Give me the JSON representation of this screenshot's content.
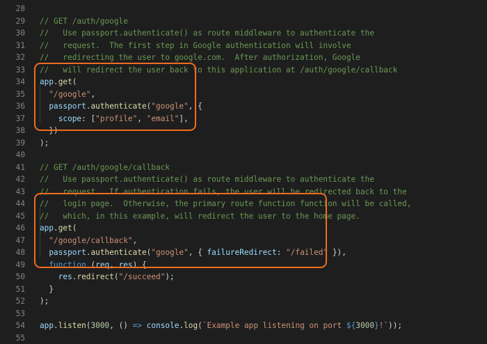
{
  "editor": {
    "lines": [
      {
        "num": "28",
        "tokens": []
      },
      {
        "num": "29",
        "tokens": [
          {
            "t": "c",
            "v": "// GET /auth/google"
          }
        ]
      },
      {
        "num": "30",
        "tokens": [
          {
            "t": "c",
            "v": "//   Use passport.authenticate() as route middleware to authenticate the"
          }
        ]
      },
      {
        "num": "31",
        "tokens": [
          {
            "t": "c",
            "v": "//   request.  The first step in Google authentication will involve"
          }
        ]
      },
      {
        "num": "32",
        "tokens": [
          {
            "t": "c",
            "v": "//   redirecting the user to google.com.  After authorization, Google"
          }
        ]
      },
      {
        "num": "33",
        "tokens": [
          {
            "t": "c",
            "v": "//   will redirect the user back to this application at /auth/google/callback"
          }
        ]
      },
      {
        "num": "34",
        "tokens": [
          {
            "t": "v",
            "v": "app"
          },
          {
            "t": "p",
            "v": "."
          },
          {
            "t": "f",
            "v": "get"
          },
          {
            "t": "p",
            "v": "("
          }
        ]
      },
      {
        "num": "35",
        "tokens": [
          {
            "t": "p",
            "v": "  "
          },
          {
            "t": "s",
            "v": "\"/google\""
          },
          {
            "t": "p",
            "v": ","
          }
        ]
      },
      {
        "num": "36",
        "tokens": [
          {
            "t": "p",
            "v": "  "
          },
          {
            "t": "v",
            "v": "passport"
          },
          {
            "t": "p",
            "v": "."
          },
          {
            "t": "f",
            "v": "authenticate"
          },
          {
            "t": "p",
            "v": "("
          },
          {
            "t": "s",
            "v": "\"google\""
          },
          {
            "t": "p",
            "v": ", {"
          }
        ]
      },
      {
        "num": "37",
        "tokens": [
          {
            "t": "p",
            "v": "    "
          },
          {
            "t": "v",
            "v": "scope"
          },
          {
            "t": "p",
            "v": ": ["
          },
          {
            "t": "s",
            "v": "\"profile\""
          },
          {
            "t": "p",
            "v": ", "
          },
          {
            "t": "s",
            "v": "\"email\""
          },
          {
            "t": "p",
            "v": "],"
          }
        ]
      },
      {
        "num": "38",
        "tokens": [
          {
            "t": "p",
            "v": "  })"
          }
        ]
      },
      {
        "num": "39",
        "tokens": [
          {
            "t": "p",
            "v": ");"
          }
        ]
      },
      {
        "num": "40",
        "tokens": []
      },
      {
        "num": "41",
        "tokens": [
          {
            "t": "c",
            "v": "// GET /auth/google/callback"
          }
        ]
      },
      {
        "num": "42",
        "tokens": [
          {
            "t": "c",
            "v": "//   Use passport.authenticate() as route middleware to authenticate the"
          }
        ]
      },
      {
        "num": "43",
        "tokens": [
          {
            "t": "c",
            "v": "//   request.  If authentication fails, the user will be redirected back to the"
          }
        ]
      },
      {
        "num": "44",
        "tokens": [
          {
            "t": "c",
            "v": "//   login page.  Otherwise, the primary route function function will be called,"
          }
        ]
      },
      {
        "num": "45",
        "tokens": [
          {
            "t": "c",
            "v": "//   which, in this example, will redirect the user to the home page."
          }
        ]
      },
      {
        "num": "46",
        "tokens": [
          {
            "t": "v",
            "v": "app"
          },
          {
            "t": "p",
            "v": "."
          },
          {
            "t": "f",
            "v": "get"
          },
          {
            "t": "p",
            "v": "("
          }
        ]
      },
      {
        "num": "47",
        "tokens": [
          {
            "t": "p",
            "v": "  "
          },
          {
            "t": "s",
            "v": "\"/google/callback\""
          },
          {
            "t": "p",
            "v": ","
          }
        ]
      },
      {
        "num": "48",
        "tokens": [
          {
            "t": "p",
            "v": "  "
          },
          {
            "t": "v",
            "v": "passport"
          },
          {
            "t": "p",
            "v": "."
          },
          {
            "t": "f",
            "v": "authenticate"
          },
          {
            "t": "p",
            "v": "("
          },
          {
            "t": "s",
            "v": "\"google\""
          },
          {
            "t": "p",
            "v": ", { "
          },
          {
            "t": "v",
            "v": "failureRedirect"
          },
          {
            "t": "p",
            "v": ": "
          },
          {
            "t": "s",
            "v": "\"/failed\""
          },
          {
            "t": "p",
            "v": " }),"
          }
        ]
      },
      {
        "num": "49",
        "tokens": [
          {
            "t": "p",
            "v": "  "
          },
          {
            "t": "k",
            "v": "function"
          },
          {
            "t": "p",
            "v": " ("
          },
          {
            "t": "v",
            "v": "req"
          },
          {
            "t": "p",
            "v": ", "
          },
          {
            "t": "v",
            "v": "res"
          },
          {
            "t": "p",
            "v": ") {"
          }
        ]
      },
      {
        "num": "50",
        "tokens": [
          {
            "t": "p",
            "v": "    "
          },
          {
            "t": "v",
            "v": "res"
          },
          {
            "t": "p",
            "v": "."
          },
          {
            "t": "f",
            "v": "redirect"
          },
          {
            "t": "p",
            "v": "("
          },
          {
            "t": "s",
            "v": "\"/succeed\""
          },
          {
            "t": "p",
            "v": ");"
          }
        ]
      },
      {
        "num": "51",
        "tokens": [
          {
            "t": "p",
            "v": "  }"
          }
        ]
      },
      {
        "num": "52",
        "tokens": [
          {
            "t": "p",
            "v": ");"
          }
        ]
      },
      {
        "num": "53",
        "tokens": []
      },
      {
        "num": "54",
        "tokens": [
          {
            "t": "v",
            "v": "app"
          },
          {
            "t": "p",
            "v": "."
          },
          {
            "t": "f",
            "v": "listen"
          },
          {
            "t": "p",
            "v": "("
          },
          {
            "t": "n",
            "v": "3000"
          },
          {
            "t": "p",
            "v": ", () "
          },
          {
            "t": "k",
            "v": "=>"
          },
          {
            "t": "p",
            "v": " "
          },
          {
            "t": "v",
            "v": "console"
          },
          {
            "t": "p",
            "v": "."
          },
          {
            "t": "f",
            "v": "log"
          },
          {
            "t": "p",
            "v": "("
          },
          {
            "t": "s",
            "v": "`Example app listening on port "
          },
          {
            "t": "k",
            "v": "${"
          },
          {
            "t": "n",
            "v": "3000"
          },
          {
            "t": "k",
            "v": "}"
          },
          {
            "t": "s",
            "v": "!`"
          },
          {
            "t": "p",
            "v": "));"
          }
        ]
      },
      {
        "num": "55",
        "tokens": []
      }
    ]
  },
  "colors": {
    "background": "#1e1e1e",
    "line_number": "#858585",
    "comment": "#6a9955",
    "string": "#ce9178",
    "variable": "#9cdcfe",
    "function": "#dcdcaa",
    "keyword": "#569cd6",
    "number": "#b5cea8",
    "punctuation": "#d4d4d4",
    "highlight_border": "#f06d1f"
  },
  "highlights": [
    {
      "label": "first-route-box",
      "from_line": "34",
      "to_line": "39"
    },
    {
      "label": "callback-route-box",
      "from_line": "46",
      "to_line": "52"
    }
  ]
}
